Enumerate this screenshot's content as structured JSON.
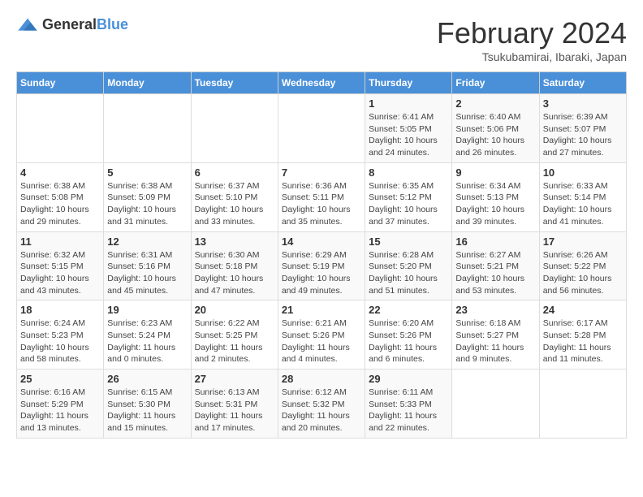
{
  "header": {
    "logo_general": "General",
    "logo_blue": "Blue",
    "month_year": "February 2024",
    "location": "Tsukubamirai, Ibaraki, Japan"
  },
  "weekdays": [
    "Sunday",
    "Monday",
    "Tuesday",
    "Wednesday",
    "Thursday",
    "Friday",
    "Saturday"
  ],
  "weeks": [
    [
      {
        "day": "",
        "info": ""
      },
      {
        "day": "",
        "info": ""
      },
      {
        "day": "",
        "info": ""
      },
      {
        "day": "",
        "info": ""
      },
      {
        "day": "1",
        "info": "Sunrise: 6:41 AM\nSunset: 5:05 PM\nDaylight: 10 hours and 24 minutes."
      },
      {
        "day": "2",
        "info": "Sunrise: 6:40 AM\nSunset: 5:06 PM\nDaylight: 10 hours and 26 minutes."
      },
      {
        "day": "3",
        "info": "Sunrise: 6:39 AM\nSunset: 5:07 PM\nDaylight: 10 hours and 27 minutes."
      }
    ],
    [
      {
        "day": "4",
        "info": "Sunrise: 6:38 AM\nSunset: 5:08 PM\nDaylight: 10 hours and 29 minutes."
      },
      {
        "day": "5",
        "info": "Sunrise: 6:38 AM\nSunset: 5:09 PM\nDaylight: 10 hours and 31 minutes."
      },
      {
        "day": "6",
        "info": "Sunrise: 6:37 AM\nSunset: 5:10 PM\nDaylight: 10 hours and 33 minutes."
      },
      {
        "day": "7",
        "info": "Sunrise: 6:36 AM\nSunset: 5:11 PM\nDaylight: 10 hours and 35 minutes."
      },
      {
        "day": "8",
        "info": "Sunrise: 6:35 AM\nSunset: 5:12 PM\nDaylight: 10 hours and 37 minutes."
      },
      {
        "day": "9",
        "info": "Sunrise: 6:34 AM\nSunset: 5:13 PM\nDaylight: 10 hours and 39 minutes."
      },
      {
        "day": "10",
        "info": "Sunrise: 6:33 AM\nSunset: 5:14 PM\nDaylight: 10 hours and 41 minutes."
      }
    ],
    [
      {
        "day": "11",
        "info": "Sunrise: 6:32 AM\nSunset: 5:15 PM\nDaylight: 10 hours and 43 minutes."
      },
      {
        "day": "12",
        "info": "Sunrise: 6:31 AM\nSunset: 5:16 PM\nDaylight: 10 hours and 45 minutes."
      },
      {
        "day": "13",
        "info": "Sunrise: 6:30 AM\nSunset: 5:18 PM\nDaylight: 10 hours and 47 minutes."
      },
      {
        "day": "14",
        "info": "Sunrise: 6:29 AM\nSunset: 5:19 PM\nDaylight: 10 hours and 49 minutes."
      },
      {
        "day": "15",
        "info": "Sunrise: 6:28 AM\nSunset: 5:20 PM\nDaylight: 10 hours and 51 minutes."
      },
      {
        "day": "16",
        "info": "Sunrise: 6:27 AM\nSunset: 5:21 PM\nDaylight: 10 hours and 53 minutes."
      },
      {
        "day": "17",
        "info": "Sunrise: 6:26 AM\nSunset: 5:22 PM\nDaylight: 10 hours and 56 minutes."
      }
    ],
    [
      {
        "day": "18",
        "info": "Sunrise: 6:24 AM\nSunset: 5:23 PM\nDaylight: 10 hours and 58 minutes."
      },
      {
        "day": "19",
        "info": "Sunrise: 6:23 AM\nSunset: 5:24 PM\nDaylight: 11 hours and 0 minutes."
      },
      {
        "day": "20",
        "info": "Sunrise: 6:22 AM\nSunset: 5:25 PM\nDaylight: 11 hours and 2 minutes."
      },
      {
        "day": "21",
        "info": "Sunrise: 6:21 AM\nSunset: 5:26 PM\nDaylight: 11 hours and 4 minutes."
      },
      {
        "day": "22",
        "info": "Sunrise: 6:20 AM\nSunset: 5:26 PM\nDaylight: 11 hours and 6 minutes."
      },
      {
        "day": "23",
        "info": "Sunrise: 6:18 AM\nSunset: 5:27 PM\nDaylight: 11 hours and 9 minutes."
      },
      {
        "day": "24",
        "info": "Sunrise: 6:17 AM\nSunset: 5:28 PM\nDaylight: 11 hours and 11 minutes."
      }
    ],
    [
      {
        "day": "25",
        "info": "Sunrise: 6:16 AM\nSunset: 5:29 PM\nDaylight: 11 hours and 13 minutes."
      },
      {
        "day": "26",
        "info": "Sunrise: 6:15 AM\nSunset: 5:30 PM\nDaylight: 11 hours and 15 minutes."
      },
      {
        "day": "27",
        "info": "Sunrise: 6:13 AM\nSunset: 5:31 PM\nDaylight: 11 hours and 17 minutes."
      },
      {
        "day": "28",
        "info": "Sunrise: 6:12 AM\nSunset: 5:32 PM\nDaylight: 11 hours and 20 minutes."
      },
      {
        "day": "29",
        "info": "Sunrise: 6:11 AM\nSunset: 5:33 PM\nDaylight: 11 hours and 22 minutes."
      },
      {
        "day": "",
        "info": ""
      },
      {
        "day": "",
        "info": ""
      }
    ]
  ]
}
